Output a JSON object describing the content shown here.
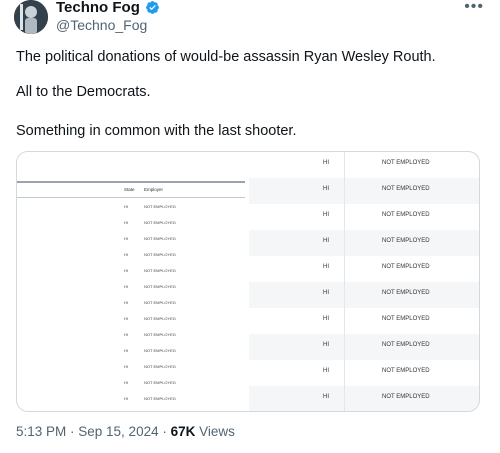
{
  "author": {
    "display_name": "Techno Fog",
    "handle": "@Techno_Fog"
  },
  "colors": {
    "verified": "#1d9bf0",
    "muted": "#536471"
  },
  "tweet": {
    "line1": "The political donations of would-be assassin Ryan Wesley Routh.",
    "line2": "All to the Democrats.",
    "line3": "Something in common with the last shooter."
  },
  "image": {
    "left_columns": {
      "state": "State",
      "employer": "Employer"
    },
    "left_rows": [
      {
        "state": "HI",
        "employer": "NOT EMPLOYED"
      },
      {
        "state": "HI",
        "employer": "NOT EMPLOYED"
      },
      {
        "state": "HI",
        "employer": "NOT EMPLOYED"
      },
      {
        "state": "HI",
        "employer": "NOT EMPLOYED"
      },
      {
        "state": "HI",
        "employer": "NOT EMPLOYED"
      },
      {
        "state": "HI",
        "employer": "NOT EMPLOYED"
      },
      {
        "state": "HI",
        "employer": "NOT EMPLOYED"
      },
      {
        "state": "HI",
        "employer": "NOT EMPLOYED"
      },
      {
        "state": "HI",
        "employer": "NOT EMPLOYED"
      },
      {
        "state": "HI",
        "employer": "NOT EMPLOYED"
      },
      {
        "state": "HI",
        "employer": "NOT EMPLOYED"
      },
      {
        "state": "HI",
        "employer": "NOT EMPLOYED"
      },
      {
        "state": "HI",
        "employer": "NOT EMPLOYED"
      }
    ],
    "right_rows": [
      {
        "state": "HI",
        "employer": "NOT EMPLOYED"
      },
      {
        "state": "HI",
        "employer": "NOT EMPLOYED"
      },
      {
        "state": "HI",
        "employer": "NOT EMPLOYED"
      },
      {
        "state": "HI",
        "employer": "NOT EMPLOYED"
      },
      {
        "state": "HI",
        "employer": "NOT EMPLOYED"
      },
      {
        "state": "HI",
        "employer": "NOT EMPLOYED"
      },
      {
        "state": "HI",
        "employer": "NOT EMPLOYED"
      },
      {
        "state": "HI",
        "employer": "NOT EMPLOYED"
      },
      {
        "state": "HI",
        "employer": "NOT EMPLOYED"
      },
      {
        "state": "HI",
        "employer": "NOT EMPLOYED"
      }
    ]
  },
  "meta": {
    "timestamp": "5:13 PM · Sep 15, 2024 · ",
    "views_count": "67K",
    "views_label": " Views"
  }
}
